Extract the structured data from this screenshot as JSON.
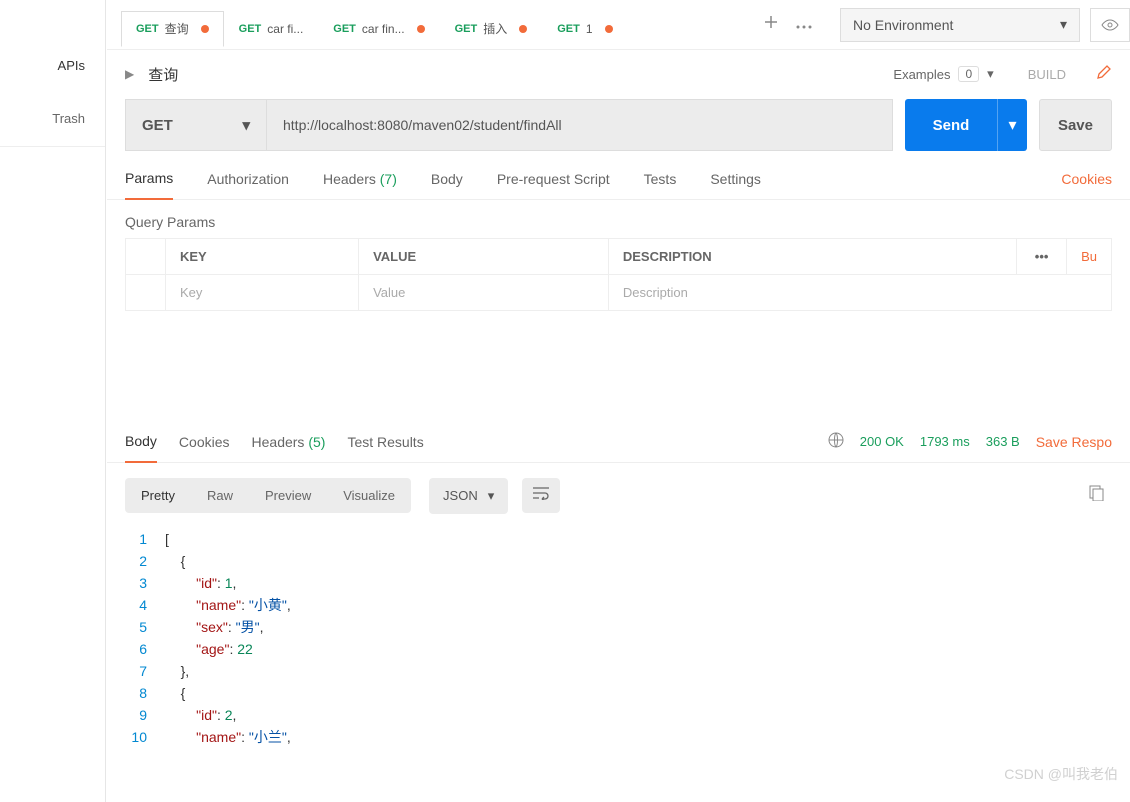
{
  "sidebar": {
    "apis": "APIs",
    "trash": "Trash"
  },
  "tabs": [
    {
      "method": "GET",
      "label": "查询",
      "dirty": true,
      "active": true
    },
    {
      "method": "GET",
      "label": "car fi...",
      "dirty": false
    },
    {
      "method": "GET",
      "label": "car fin...",
      "dirty": true
    },
    {
      "method": "GET",
      "label": "插入",
      "dirty": true
    },
    {
      "method": "GET",
      "label": "1",
      "dirty": true
    }
  ],
  "env": {
    "selected": "No Environment"
  },
  "request": {
    "name": "查询",
    "examples_label": "Examples",
    "examples_count": "0",
    "build": "BUILD",
    "method": "GET",
    "url": "http://localhost:8080/maven02/student/findAll",
    "send": "Send",
    "save": "Save"
  },
  "req_tabs": {
    "params": "Params",
    "authorization": "Authorization",
    "headers": "Headers",
    "headers_count": "(7)",
    "body": "Body",
    "prerequest": "Pre-request Script",
    "tests": "Tests",
    "settings": "Settings",
    "cookies": "Cookies"
  },
  "query_params": {
    "title": "Query Params",
    "cols": {
      "key": "KEY",
      "value": "VALUE",
      "description": "DESCRIPTION",
      "bulk": "Bu"
    },
    "placeholders": {
      "key": "Key",
      "value": "Value",
      "description": "Description"
    }
  },
  "resp_tabs": {
    "body": "Body",
    "cookies": "Cookies",
    "headers": "Headers",
    "headers_count": "(5)",
    "tests": "Test Results"
  },
  "resp_meta": {
    "status": "200 OK",
    "time": "1793 ms",
    "size": "363 B",
    "save": "Save Respo"
  },
  "view_tabs": {
    "pretty": "Pretty",
    "raw": "Raw",
    "preview": "Preview",
    "visualize": "Visualize",
    "format": "JSON"
  },
  "response_body": [
    {
      "n": "1",
      "indent": 0,
      "t": "br",
      "v": "["
    },
    {
      "n": "2",
      "indent": 1,
      "t": "br",
      "v": "{"
    },
    {
      "n": "3",
      "indent": 2,
      "t": "kv",
      "k": "\"id\"",
      "v": "1",
      "vt": "num",
      "c": ","
    },
    {
      "n": "4",
      "indent": 2,
      "t": "kv",
      "k": "\"name\"",
      "v": "\"小黄\"",
      "vt": "str",
      "c": ","
    },
    {
      "n": "5",
      "indent": 2,
      "t": "kv",
      "k": "\"sex\"",
      "v": "\"男\"",
      "vt": "str",
      "c": ","
    },
    {
      "n": "6",
      "indent": 2,
      "t": "kv",
      "k": "\"age\"",
      "v": "22",
      "vt": "num",
      "c": ""
    },
    {
      "n": "7",
      "indent": 1,
      "t": "br",
      "v": "},"
    },
    {
      "n": "8",
      "indent": 1,
      "t": "br",
      "v": "{"
    },
    {
      "n": "9",
      "indent": 2,
      "t": "kv",
      "k": "\"id\"",
      "v": "2",
      "vt": "num",
      "c": ","
    },
    {
      "n": "10",
      "indent": 2,
      "t": "kv",
      "k": "\"name\"",
      "v": "\"小兰\"",
      "vt": "str",
      "c": ","
    }
  ],
  "watermark": "CSDN @叫我老伯"
}
